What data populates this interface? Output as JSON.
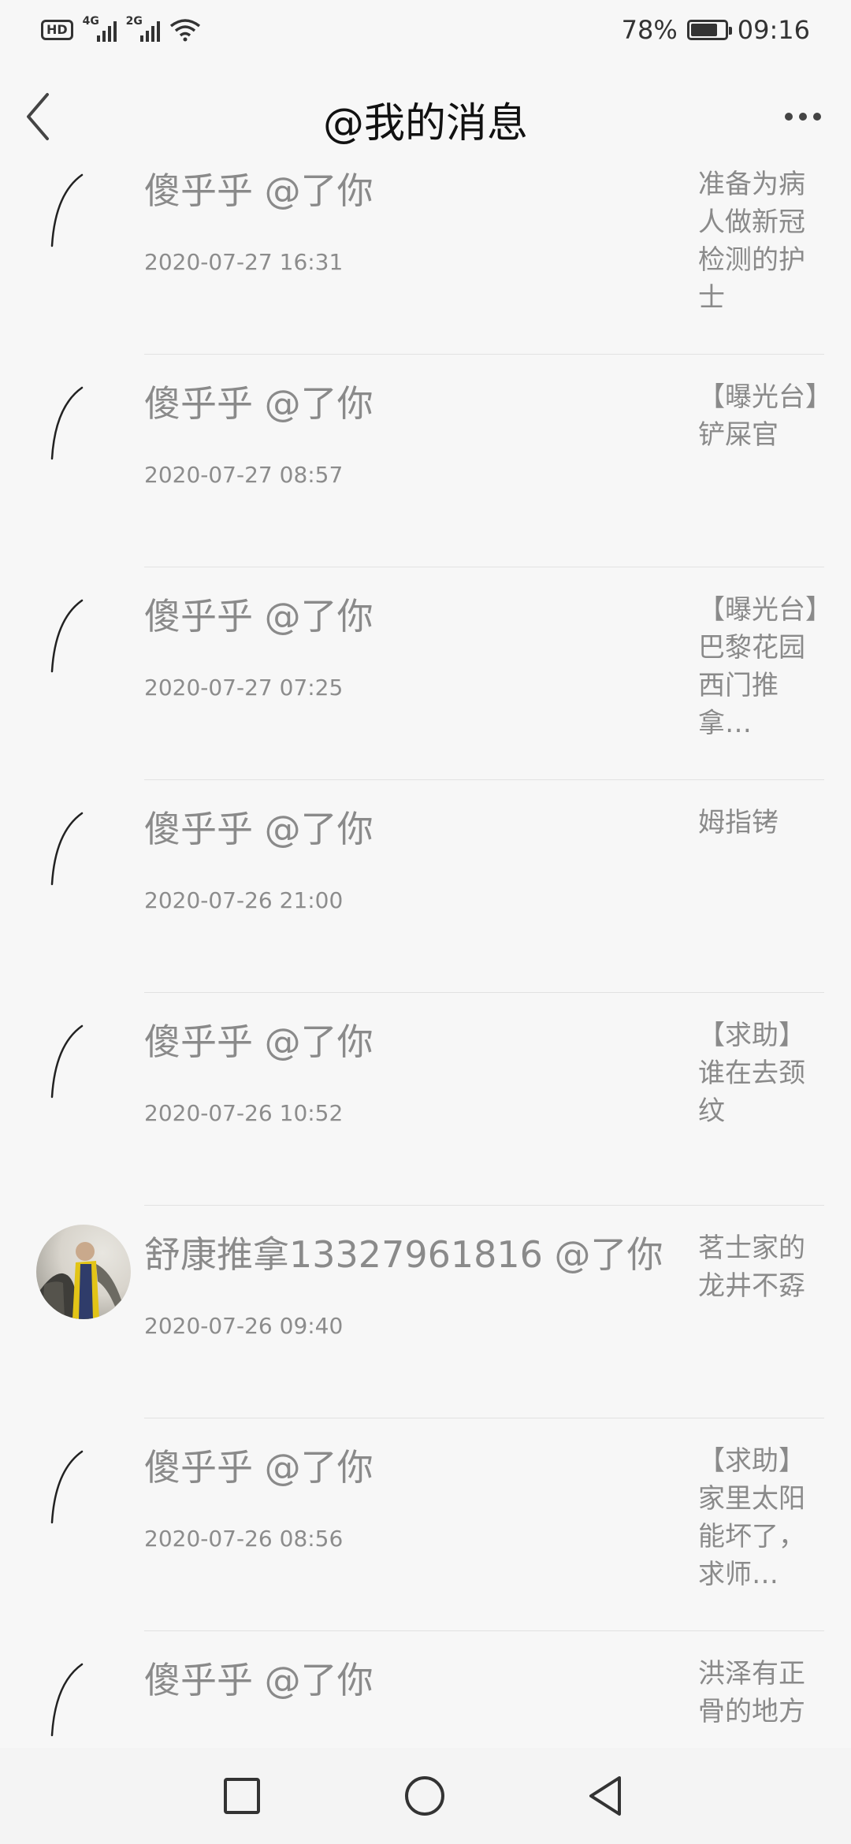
{
  "status_bar": {
    "hd": "HD",
    "net1": "4G",
    "net2": "2G",
    "battery": "78%",
    "battery_level": 0.78,
    "time": "09:16"
  },
  "header": {
    "title": "@我的消息"
  },
  "messages": [
    {
      "name": "傻乎乎 @了你",
      "time": "2020-07-27 16:31",
      "snippet": "准备为病人做新冠检测的护士",
      "avatar": "loading"
    },
    {
      "name": "傻乎乎 @了你",
      "time": "2020-07-27 08:57",
      "snippet": "【曝光台】铲屎官",
      "avatar": "loading"
    },
    {
      "name": "傻乎乎 @了你",
      "time": "2020-07-27 07:25",
      "snippet": "【曝光台】巴黎花园西门推拿…",
      "avatar": "loading"
    },
    {
      "name": "傻乎乎 @了你",
      "time": "2020-07-26 21:00",
      "snippet": "姆指铐",
      "avatar": "loading"
    },
    {
      "name": "傻乎乎 @了你",
      "time": "2020-07-26 10:52",
      "snippet": "【求助】谁在去颈纹",
      "avatar": "loading"
    },
    {
      "name": "舒康推拿13327961816 @了你",
      "time": "2020-07-26 09:40",
      "snippet": "茗士家的龙井不孬",
      "avatar": "photo"
    },
    {
      "name": "傻乎乎 @了你",
      "time": "2020-07-26 08:56",
      "snippet": "【求助】家里太阳能坏了，求师…",
      "avatar": "loading"
    },
    {
      "name": "傻乎乎 @了你",
      "time": "",
      "snippet": "洪泽有正骨的地方",
      "avatar": "loading"
    }
  ]
}
